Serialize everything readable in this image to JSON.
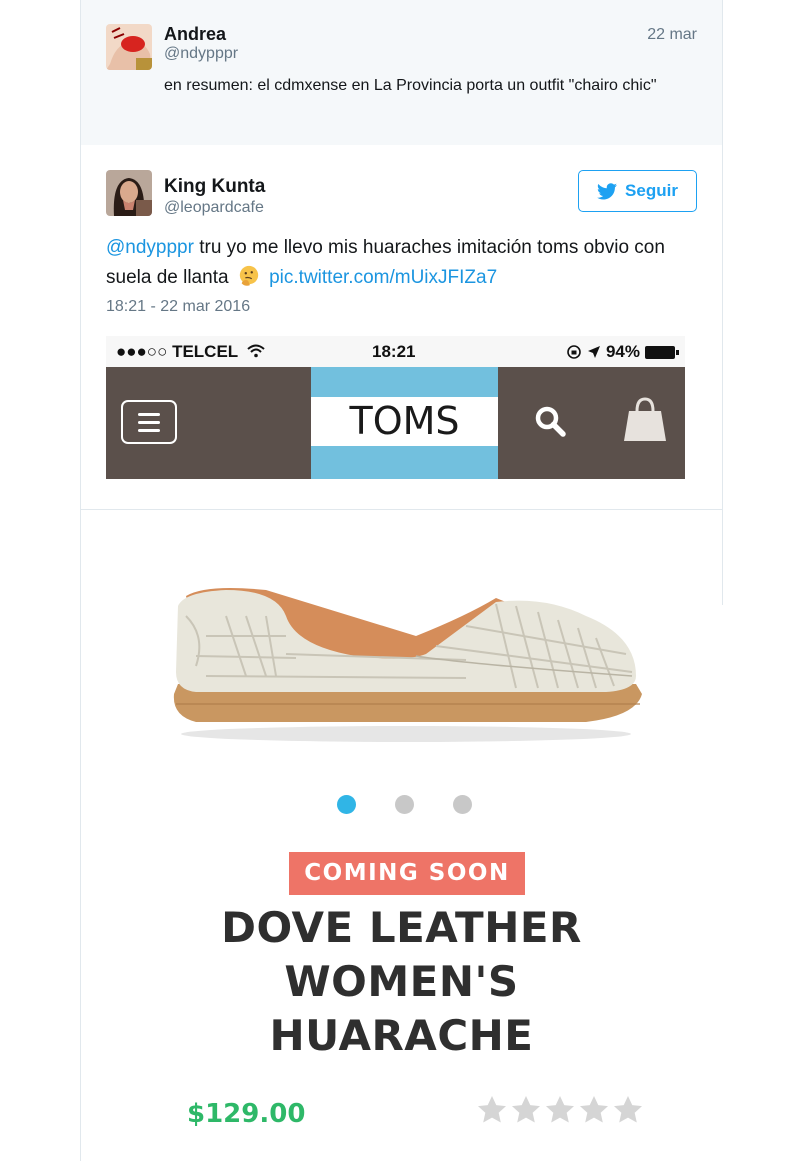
{
  "parent_tweet": {
    "name": "Andrea",
    "handle": "@ndypppr",
    "date": "22 mar",
    "text": "en resumen: el cdmxense en La Provincia porta un outfit \"chairo chic\""
  },
  "main_tweet": {
    "name": "King Kunta",
    "handle": "@leopardcafe",
    "follow_label": "Seguir",
    "mention": "@ndypppr",
    "text_part1": " tru yo me llevo mis huaraches imitación toms obvio con suela de llanta",
    "link": "pic.twitter.com/mUixJFIZa7",
    "timestamp": "18:21 - 22 mar 2016"
  },
  "phone": {
    "carrier": "●●●○○ TELCEL",
    "time": "18:21",
    "battery": "94%",
    "brand": "TOMS"
  },
  "product": {
    "badge": "COMING SOON",
    "title_line1": "DOVE LEATHER",
    "title_line2": "WOMEN'S",
    "title_line3": "HUARACHE",
    "price": "$129.00",
    "rating_stars": 0,
    "carousel_dots": 3,
    "carousel_active": 1
  },
  "colors": {
    "twitter_blue": "#1da1f2",
    "toms_blue": "#72c0de",
    "toms_bar": "#5b504b",
    "coming_soon": "#ee7467",
    "price_green": "#2eb868"
  },
  "icons": [
    "twitter-bird-icon",
    "thinking-face-emoji",
    "wifi-icon",
    "location-arrow-icon",
    "hamburger-menu-icon",
    "search-icon",
    "shopping-bag-icon",
    "star-icon"
  ]
}
